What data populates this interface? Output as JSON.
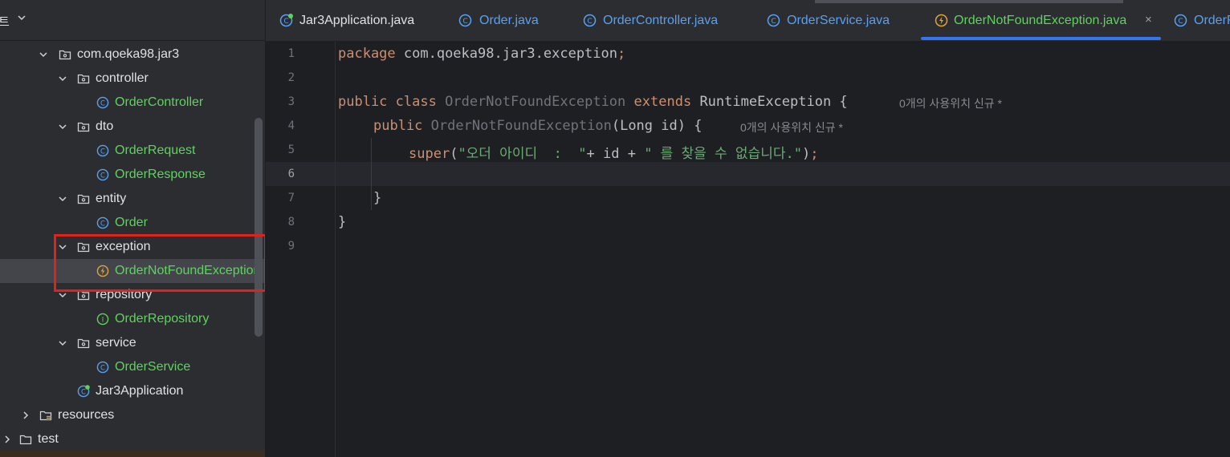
{
  "project_panel": {
    "title": "트",
    "tree": [
      {
        "name": "tree-folder-com-qoeka98-jar3",
        "label": "com.qoeka98.jar3",
        "kind": "package",
        "expanded": true,
        "depth": 0
      },
      {
        "name": "tree-folder-controller",
        "label": "controller",
        "kind": "package",
        "expanded": true,
        "depth": 1
      },
      {
        "name": "tree-file-order-controller",
        "label": "OrderController",
        "kind": "class",
        "depth": 2
      },
      {
        "name": "tree-folder-dto",
        "label": "dto",
        "kind": "package",
        "expanded": true,
        "depth": 1
      },
      {
        "name": "tree-file-order-request",
        "label": "OrderRequest",
        "kind": "class",
        "depth": 2
      },
      {
        "name": "tree-file-order-response",
        "label": "OrderResponse",
        "kind": "class",
        "depth": 2
      },
      {
        "name": "tree-folder-entity",
        "label": "entity",
        "kind": "package",
        "expanded": true,
        "depth": 1
      },
      {
        "name": "tree-file-order",
        "label": "Order",
        "kind": "class",
        "depth": 2
      },
      {
        "name": "tree-folder-exception",
        "label": "exception",
        "kind": "package",
        "expanded": true,
        "depth": 1
      },
      {
        "name": "tree-file-order-not-found-exception",
        "label": "OrderNotFoundException",
        "kind": "exception",
        "depth": 2,
        "selected": true
      },
      {
        "name": "tree-folder-repository",
        "label": "repository",
        "kind": "package",
        "expanded": true,
        "depth": 1
      },
      {
        "name": "tree-file-order-repository",
        "label": "OrderRepository",
        "kind": "interface",
        "depth": 2
      },
      {
        "name": "tree-folder-service",
        "label": "service",
        "kind": "package",
        "expanded": true,
        "depth": 1
      },
      {
        "name": "tree-file-order-service",
        "label": "OrderService",
        "kind": "class",
        "depth": 2
      },
      {
        "name": "tree-file-jar3-application",
        "label": "Jar3Application",
        "kind": "app",
        "depth": 1
      },
      {
        "name": "tree-folder-resources",
        "label": "resources",
        "kind": "resources",
        "expanded": false,
        "depth": -1
      },
      {
        "name": "tree-folder-test",
        "label": "test",
        "kind": "folder",
        "expanded": false,
        "depth": -2
      }
    ]
  },
  "tabs": [
    {
      "label": "Jar3Application.java",
      "icon": "spring-app-class-icon",
      "active": false
    },
    {
      "label": "Order.java",
      "icon": "class-icon",
      "active": false
    },
    {
      "label": "OrderController.java",
      "icon": "class-icon",
      "active": false
    },
    {
      "label": "OrderService.java",
      "icon": "class-icon",
      "active": false
    },
    {
      "label": "OrderNotFoundException.java",
      "icon": "exception-class-icon",
      "active": true,
      "close": "×"
    },
    {
      "label": "OrderR",
      "icon": "class-icon",
      "active": false
    }
  ],
  "editor": {
    "line_numbers": [
      "1",
      "2",
      "3",
      "4",
      "5",
      "6",
      "7",
      "8",
      "9"
    ],
    "current_line": 6,
    "code": {
      "l1_kw": "package",
      "l1_rest": " com.qoeka98.jar3.exception",
      "l1_semi": ";",
      "l3_kw1": "public",
      "l3_kw2": "class",
      "l3_name": "OrderNotFoundException",
      "l3_kw3": "extends",
      "l3_super": "RuntimeException {",
      "l3_hint": "0개의 사용위치   신규 *",
      "l4_kw": "public",
      "l4_name": "OrderNotFoundException",
      "l4_params": "(Long id) {",
      "l4_hint": "0개의 사용위치   신규 *",
      "l5_kw": "super",
      "l5_open": "(",
      "l5_str1": "\"오더 아이디  :  \"",
      "l5_mid": "+ id + ",
      "l5_str2": "\" 를 찾을 수 없습니다.\"",
      "l5_close": ")",
      "l5_semi": ";",
      "l7": "}",
      "l8": "}"
    }
  },
  "colors": {
    "highlight_box": "#e0221a",
    "accent_blue": "#3574f0",
    "file_green": "#5fd35f",
    "keyword": "#cf8e6d",
    "string": "#6aab73"
  }
}
